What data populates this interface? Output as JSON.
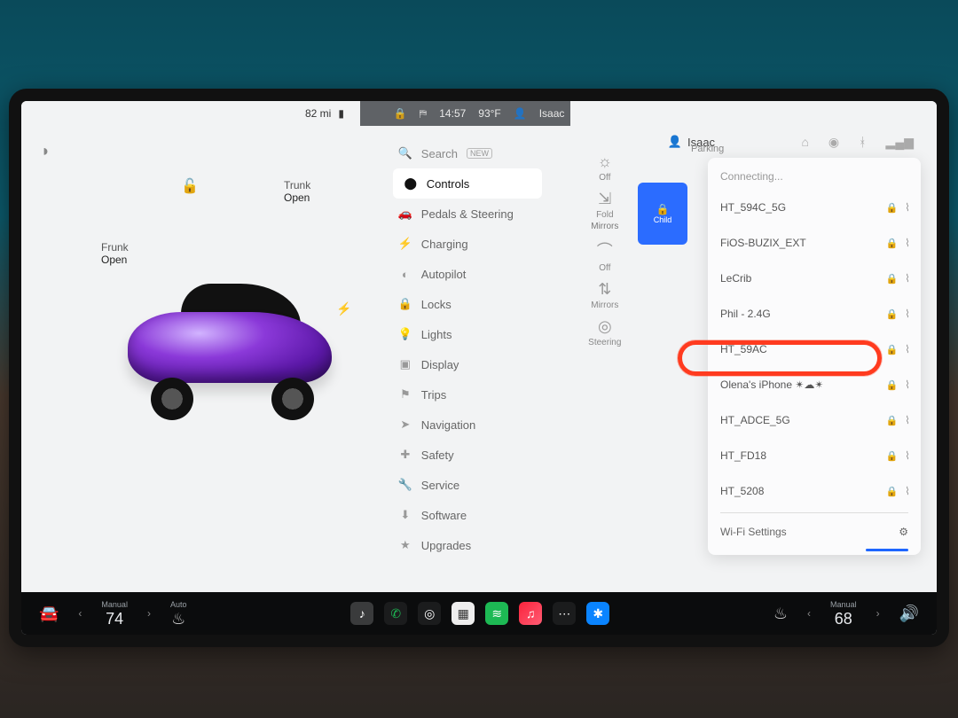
{
  "statusbar": {
    "range": "82 mi",
    "battery_icon": "battery-icon",
    "time": "14:57",
    "temp": "93°F",
    "profile": "Isaac",
    "lock_icon": "lock-icon",
    "seatbelt_icon": "seatbelt-icon"
  },
  "carpane": {
    "lock_state": "unlocked",
    "frunk_label": "Frunk",
    "frunk_state": "Open",
    "trunk_label": "Trunk",
    "trunk_state": "Open",
    "charge_icon": "bolt-icon"
  },
  "menu": {
    "search_label": "Search",
    "search_badge": "NEW",
    "items": [
      {
        "icon": "⬤",
        "label": "Controls",
        "active": true
      },
      {
        "icon": "🚗",
        "label": "Pedals & Steering"
      },
      {
        "icon": "⚡",
        "label": "Charging"
      },
      {
        "icon": "◐",
        "label": "Autopilot"
      },
      {
        "icon": "🔒",
        "label": "Locks"
      },
      {
        "icon": "💡",
        "label": "Lights"
      },
      {
        "icon": "▣",
        "label": "Display"
      },
      {
        "icon": "⚑",
        "label": "Trips"
      },
      {
        "icon": "➤",
        "label": "Navigation"
      },
      {
        "icon": "✚",
        "label": "Safety"
      },
      {
        "icon": "🔧",
        "label": "Service"
      },
      {
        "icon": "⬇",
        "label": "Software"
      },
      {
        "icon": "★",
        "label": "Upgrades"
      }
    ]
  },
  "tiles": [
    {
      "icon": "☼",
      "label": "Off",
      "sub": ""
    },
    {
      "icon": "⇲",
      "label": "Fold",
      "sub": "Mirrors"
    },
    {
      "icon": "⌒",
      "label": "Off",
      "sub": ""
    },
    {
      "icon": "⇅",
      "label": "Mirrors",
      "sub": ""
    },
    {
      "icon": "◎",
      "label": "Steering",
      "sub": ""
    }
  ],
  "parking_label": "Parking",
  "child_card": "Child",
  "profile_row": {
    "label": "Isaac"
  },
  "status_icons": {
    "home": "home-icon",
    "sentry": "sentry-icon",
    "bluetooth": "bluetooth-icon",
    "signal": "signal-icon"
  },
  "wifi": {
    "header": "Connecting...",
    "networks": [
      {
        "name": "HT_594C_5G",
        "locked": true
      },
      {
        "name": "FiOS-BUZIX_EXT",
        "locked": true
      },
      {
        "name": "LeCrib",
        "locked": true
      },
      {
        "name": "Phil - 2.4G",
        "locked": true
      },
      {
        "name": "HT_59AC",
        "locked": true
      },
      {
        "name": "Olena's iPhone ✴︎☁︎✴︎",
        "locked": true,
        "highlight": true
      },
      {
        "name": "HT_ADCE_5G",
        "locked": true
      },
      {
        "name": "HT_FD18",
        "locked": true
      },
      {
        "name": "HT_5208",
        "locked": true
      }
    ],
    "settings_label": "Wi-Fi Settings"
  },
  "dock": {
    "left_temp_mode": "Manual",
    "left_temp": "74",
    "left_seat_mode": "Auto",
    "right_temp_mode": "Manual",
    "right_temp": "68",
    "right_seat_mode": "",
    "apps": [
      {
        "name": "music-app",
        "cls": "ai-gray",
        "glyph": "♪"
      },
      {
        "name": "phone-app",
        "cls": "ai-dark",
        "glyph": "✆",
        "color": "#1db954"
      },
      {
        "name": "camera-app",
        "cls": "ai-dark",
        "glyph": "◎"
      },
      {
        "name": "calendar-app",
        "cls": "ai-white",
        "glyph": "▦"
      },
      {
        "name": "spotify-app",
        "cls": "ai-green",
        "glyph": "≋"
      },
      {
        "name": "apple-music-app",
        "cls": "ai-red",
        "glyph": "♫"
      },
      {
        "name": "more-apps",
        "cls": "ai-dark",
        "glyph": "⋯"
      },
      {
        "name": "bluetooth-app",
        "cls": "ai-blue",
        "glyph": "✱"
      }
    ]
  }
}
